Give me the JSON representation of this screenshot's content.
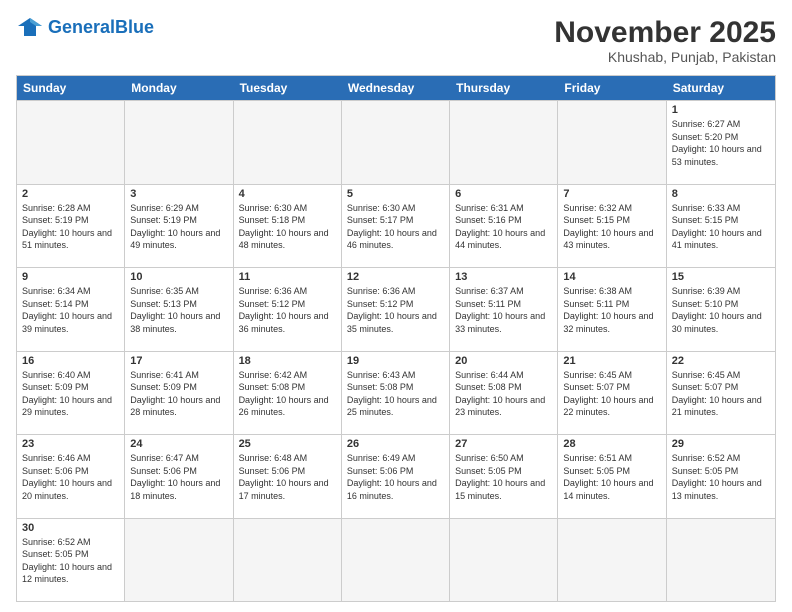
{
  "header": {
    "logo_general": "General",
    "logo_blue": "Blue",
    "month_title": "November 2025",
    "subtitle": "Khushab, Punjab, Pakistan"
  },
  "days_of_week": [
    "Sunday",
    "Monday",
    "Tuesday",
    "Wednesday",
    "Thursday",
    "Friday",
    "Saturday"
  ],
  "weeks": [
    [
      {
        "day": "",
        "empty": true
      },
      {
        "day": "",
        "empty": true
      },
      {
        "day": "",
        "empty": true
      },
      {
        "day": "",
        "empty": true
      },
      {
        "day": "",
        "empty": true
      },
      {
        "day": "",
        "empty": true
      },
      {
        "day": "1",
        "sunrise": "Sunrise: 6:27 AM",
        "sunset": "Sunset: 5:20 PM",
        "daylight": "Daylight: 10 hours and 53 minutes."
      }
    ],
    [
      {
        "day": "2",
        "sunrise": "Sunrise: 6:28 AM",
        "sunset": "Sunset: 5:19 PM",
        "daylight": "Daylight: 10 hours and 51 minutes."
      },
      {
        "day": "3",
        "sunrise": "Sunrise: 6:29 AM",
        "sunset": "Sunset: 5:19 PM",
        "daylight": "Daylight: 10 hours and 49 minutes."
      },
      {
        "day": "4",
        "sunrise": "Sunrise: 6:30 AM",
        "sunset": "Sunset: 5:18 PM",
        "daylight": "Daylight: 10 hours and 48 minutes."
      },
      {
        "day": "5",
        "sunrise": "Sunrise: 6:30 AM",
        "sunset": "Sunset: 5:17 PM",
        "daylight": "Daylight: 10 hours and 46 minutes."
      },
      {
        "day": "6",
        "sunrise": "Sunrise: 6:31 AM",
        "sunset": "Sunset: 5:16 PM",
        "daylight": "Daylight: 10 hours and 44 minutes."
      },
      {
        "day": "7",
        "sunrise": "Sunrise: 6:32 AM",
        "sunset": "Sunset: 5:15 PM",
        "daylight": "Daylight: 10 hours and 43 minutes."
      },
      {
        "day": "8",
        "sunrise": "Sunrise: 6:33 AM",
        "sunset": "Sunset: 5:15 PM",
        "daylight": "Daylight: 10 hours and 41 minutes."
      }
    ],
    [
      {
        "day": "9",
        "sunrise": "Sunrise: 6:34 AM",
        "sunset": "Sunset: 5:14 PM",
        "daylight": "Daylight: 10 hours and 39 minutes."
      },
      {
        "day": "10",
        "sunrise": "Sunrise: 6:35 AM",
        "sunset": "Sunset: 5:13 PM",
        "daylight": "Daylight: 10 hours and 38 minutes."
      },
      {
        "day": "11",
        "sunrise": "Sunrise: 6:36 AM",
        "sunset": "Sunset: 5:12 PM",
        "daylight": "Daylight: 10 hours and 36 minutes."
      },
      {
        "day": "12",
        "sunrise": "Sunrise: 6:36 AM",
        "sunset": "Sunset: 5:12 PM",
        "daylight": "Daylight: 10 hours and 35 minutes."
      },
      {
        "day": "13",
        "sunrise": "Sunrise: 6:37 AM",
        "sunset": "Sunset: 5:11 PM",
        "daylight": "Daylight: 10 hours and 33 minutes."
      },
      {
        "day": "14",
        "sunrise": "Sunrise: 6:38 AM",
        "sunset": "Sunset: 5:11 PM",
        "daylight": "Daylight: 10 hours and 32 minutes."
      },
      {
        "day": "15",
        "sunrise": "Sunrise: 6:39 AM",
        "sunset": "Sunset: 5:10 PM",
        "daylight": "Daylight: 10 hours and 30 minutes."
      }
    ],
    [
      {
        "day": "16",
        "sunrise": "Sunrise: 6:40 AM",
        "sunset": "Sunset: 5:09 PM",
        "daylight": "Daylight: 10 hours and 29 minutes."
      },
      {
        "day": "17",
        "sunrise": "Sunrise: 6:41 AM",
        "sunset": "Sunset: 5:09 PM",
        "daylight": "Daylight: 10 hours and 28 minutes."
      },
      {
        "day": "18",
        "sunrise": "Sunrise: 6:42 AM",
        "sunset": "Sunset: 5:08 PM",
        "daylight": "Daylight: 10 hours and 26 minutes."
      },
      {
        "day": "19",
        "sunrise": "Sunrise: 6:43 AM",
        "sunset": "Sunset: 5:08 PM",
        "daylight": "Daylight: 10 hours and 25 minutes."
      },
      {
        "day": "20",
        "sunrise": "Sunrise: 6:44 AM",
        "sunset": "Sunset: 5:08 PM",
        "daylight": "Daylight: 10 hours and 23 minutes."
      },
      {
        "day": "21",
        "sunrise": "Sunrise: 6:45 AM",
        "sunset": "Sunset: 5:07 PM",
        "daylight": "Daylight: 10 hours and 22 minutes."
      },
      {
        "day": "22",
        "sunrise": "Sunrise: 6:45 AM",
        "sunset": "Sunset: 5:07 PM",
        "daylight": "Daylight: 10 hours and 21 minutes."
      }
    ],
    [
      {
        "day": "23",
        "sunrise": "Sunrise: 6:46 AM",
        "sunset": "Sunset: 5:06 PM",
        "daylight": "Daylight: 10 hours and 20 minutes."
      },
      {
        "day": "24",
        "sunrise": "Sunrise: 6:47 AM",
        "sunset": "Sunset: 5:06 PM",
        "daylight": "Daylight: 10 hours and 18 minutes."
      },
      {
        "day": "25",
        "sunrise": "Sunrise: 6:48 AM",
        "sunset": "Sunset: 5:06 PM",
        "daylight": "Daylight: 10 hours and 17 minutes."
      },
      {
        "day": "26",
        "sunrise": "Sunrise: 6:49 AM",
        "sunset": "Sunset: 5:06 PM",
        "daylight": "Daylight: 10 hours and 16 minutes."
      },
      {
        "day": "27",
        "sunrise": "Sunrise: 6:50 AM",
        "sunset": "Sunset: 5:05 PM",
        "daylight": "Daylight: 10 hours and 15 minutes."
      },
      {
        "day": "28",
        "sunrise": "Sunrise: 6:51 AM",
        "sunset": "Sunset: 5:05 PM",
        "daylight": "Daylight: 10 hours and 14 minutes."
      },
      {
        "day": "29",
        "sunrise": "Sunrise: 6:52 AM",
        "sunset": "Sunset: 5:05 PM",
        "daylight": "Daylight: 10 hours and 13 minutes."
      }
    ],
    [
      {
        "day": "30",
        "sunrise": "Sunrise: 6:52 AM",
        "sunset": "Sunset: 5:05 PM",
        "daylight": "Daylight: 10 hours and 12 minutes."
      },
      {
        "day": "",
        "empty": true
      },
      {
        "day": "",
        "empty": true
      },
      {
        "day": "",
        "empty": true
      },
      {
        "day": "",
        "empty": true
      },
      {
        "day": "",
        "empty": true
      },
      {
        "day": "",
        "empty": true
      }
    ]
  ]
}
